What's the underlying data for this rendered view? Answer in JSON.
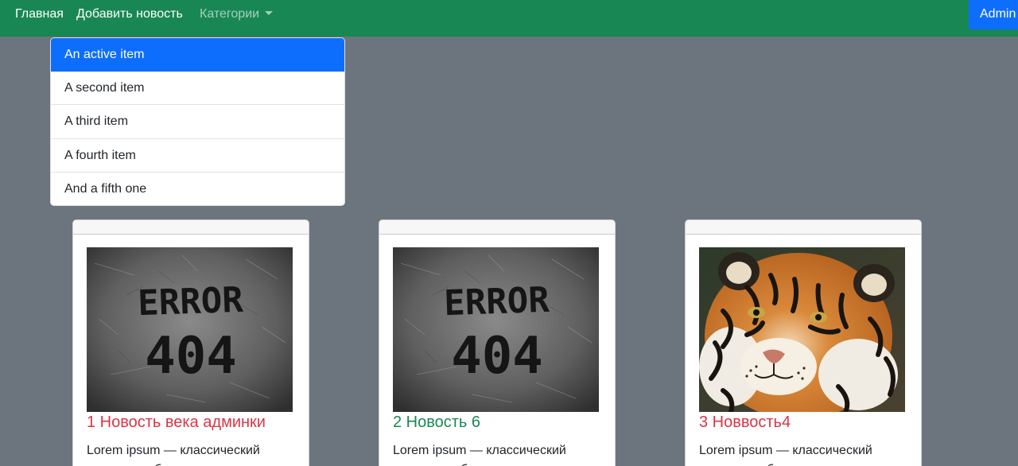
{
  "navbar": {
    "home": "Главная",
    "add_news": "Добавить новость",
    "categories": "Категории",
    "admin": "Admin",
    "bg_color": "#198754"
  },
  "dropdown": {
    "items": [
      {
        "label": "An active item",
        "active": true
      },
      {
        "label": "A second item",
        "active": false
      },
      {
        "label": "A third item",
        "active": false
      },
      {
        "label": "A fourth item",
        "active": false
      },
      {
        "label": "And a fifth one",
        "active": false
      }
    ]
  },
  "cards": [
    {
      "image": "error-404-graffiti-image",
      "title": "1 Новость века админки",
      "title_color": "#dc3545",
      "text": "Lorem ipsum — классический вариант рыбы-текста для"
    },
    {
      "image": "error-404-graffiti-image",
      "title": "2 Новость 6",
      "title_color": "#198754",
      "text": "Lorem ipsum — классический вариант рыбы-текста для"
    },
    {
      "image": "tiger-photo-image",
      "title": "3 Новвость4",
      "title_color": "#dc3545",
      "text": "Lorem ipsum — классический вариант рыбы-текста для"
    }
  ]
}
